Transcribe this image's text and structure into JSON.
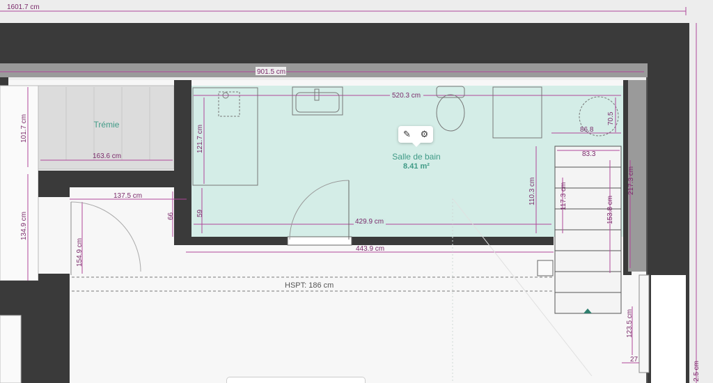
{
  "dimensions": {
    "top_total": "1601.7 cm",
    "wall_top": "901.5 cm",
    "bath_width_top": "520.3 cm",
    "tremie_width": "163.6 cm",
    "left_upper": "101.7 cm",
    "left_lower": "134.9 cm",
    "shower_height": "121.7 cm",
    "door_width": "137.5 cm",
    "door_left_height": "154.9 cm",
    "small_66": "66",
    "small_59": "59",
    "bath_inner_width": "429.9 cm",
    "bath_outer_width": "443.9 cm",
    "bath_right_height": "110.3 cm",
    "stair_width": "83.3",
    "stair_height": "117.3 cm",
    "stair_height_2": "153.8 cm",
    "right_wall_height": "217.3 cm",
    "circle_width": "86.8",
    "circle_height": "70.5",
    "right_lower": "123.5 cm",
    "right_small": "27",
    "right_edge": "2.5 cm"
  },
  "rooms": {
    "tremie_label": "Trémie",
    "bath_label": "Salle de bain",
    "bath_area": "8.41 m²"
  },
  "hspt_label": "HSPT: 186 cm",
  "toolbar": {
    "edit_icon": "pencil-icon",
    "settings_icon": "gear-icon"
  },
  "colors": {
    "wall": "#3a3a3a",
    "room_fill": "#d2ece6",
    "dimension": "#b0479a",
    "room_label": "#3f9a86"
  }
}
